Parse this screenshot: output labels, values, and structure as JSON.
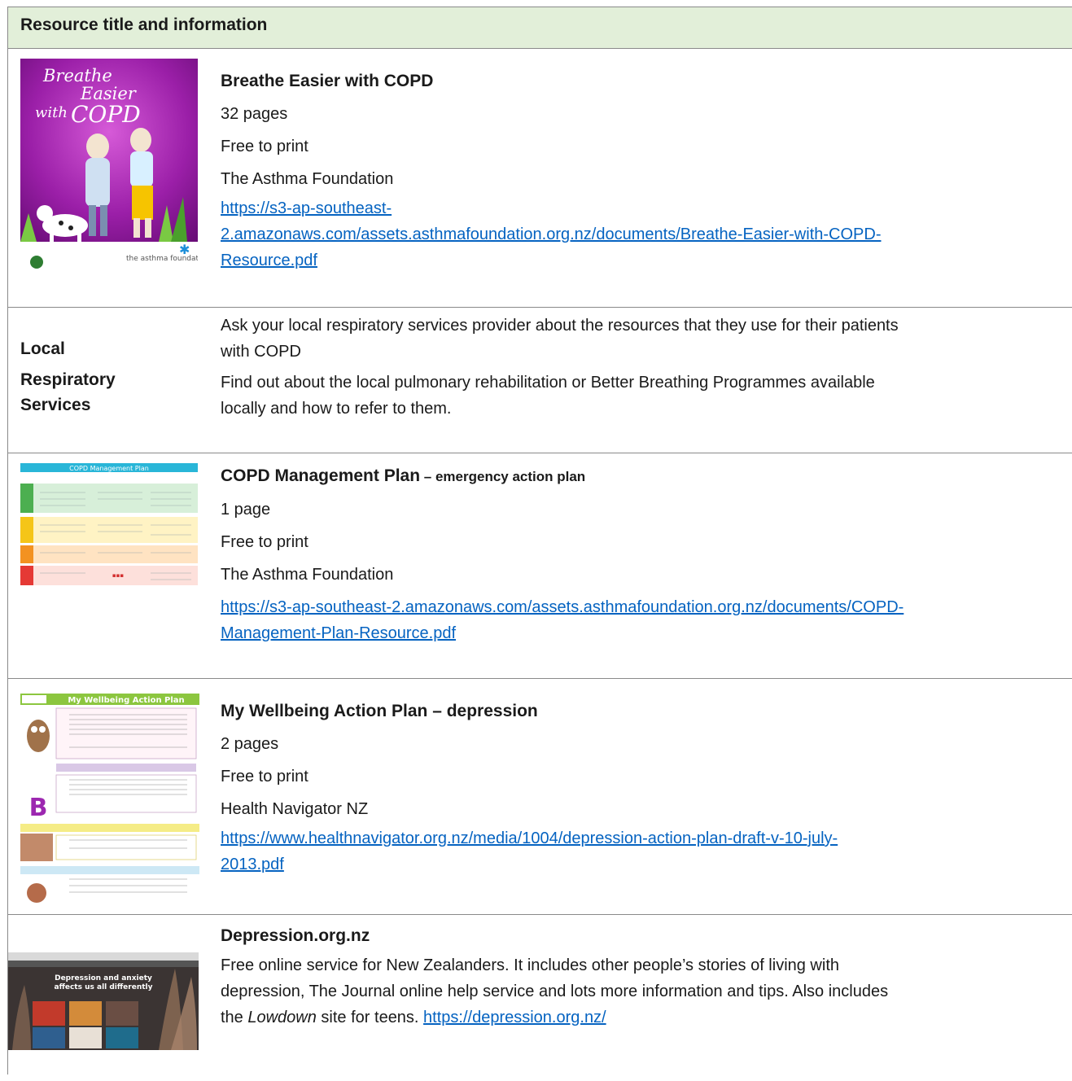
{
  "header": "Resource title and information",
  "rows": [
    {
      "title": "Breathe Easier with COPD",
      "pages": "32 pages",
      "cost": "Free to print",
      "org": "The Asthma Foundation",
      "link_line1": "https://s3-ap-southeast-",
      "link_line2": "2.amazonaws.com/assets.asthmafoundation.org.nz/documents/Breathe-Easier-with-COPD-",
      "link_line3": "Resource.pdf",
      "cover_title_1": "Breathe",
      "cover_title_2": "Easier",
      "cover_title_3": "with",
      "cover_title_4": "COPD",
      "cover_logo": "the asthma foundation"
    },
    {
      "label_1": "Local",
      "label_2": "Respiratory",
      "label_3": "Services",
      "para1_line1": "Ask your local respiratory services provider about the resources that they use for their patients",
      "para1_line2": "with COPD",
      "para2_line1": "Find out about the local pulmonary rehabilitation or Better Breathing Programmes available",
      "para2_line2": "locally and how to refer to them."
    },
    {
      "title": "COPD Management Plan",
      "subtitle": " – emergency action plan",
      "pages": "1 page",
      "cost": "Free to print",
      "org": "The Asthma Foundation",
      "link_line1": "https://s3-ap-southeast-2.amazonaws.com/assets.asthmafoundation.org.nz/documents/COPD-",
      "link_line2": "Management-Plan-Resource.pdf",
      "thumb_title": "COPD Management Plan"
    },
    {
      "title": "My Wellbeing Action Plan – depression",
      "pages": "2 pages",
      "cost": "Free to print",
      "org": "Health Navigator NZ",
      "link_line1": "https://www.healthnavigator.org.nz/media/1004/depression-action-plan-draft-v-10-july-",
      "link_line2": "2013.pdf",
      "thumb_title": "My Wellbeing Action Plan"
    },
    {
      "title": "Depression.org.nz",
      "line1": "Free online service for New Zealanders. It includes other people’s stories of living with",
      "line2": "depression, The Journal online help service and lots more information and tips. Also includes",
      "line3_a": "the ",
      "line3_em": "Lowdown",
      "line3_b": " site for teens. ",
      "link": "https://depression.org.nz/",
      "thumb_title_1": "Depression and anxiety",
      "thumb_title_2": "affects us all differently"
    }
  ]
}
